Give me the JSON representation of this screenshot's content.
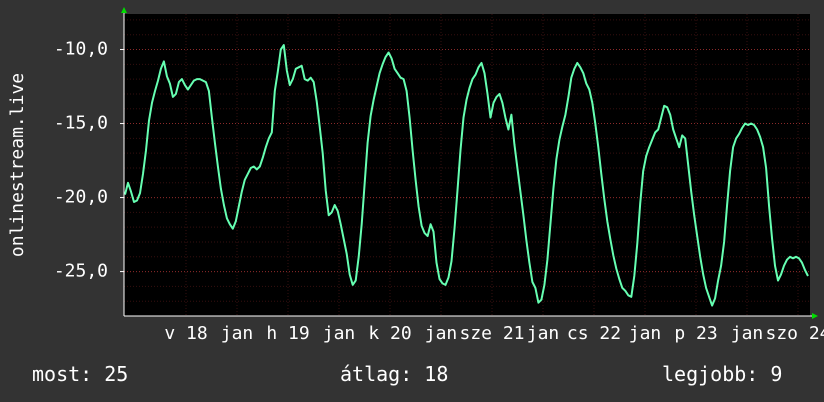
{
  "chart_data": {
    "type": "line",
    "ylabel": "onlinestream.live",
    "ylim": [
      -28,
      -7.6
    ],
    "y_ticks": [
      -10,
      -15,
      -20,
      -25
    ],
    "y_tick_labels": [
      "-10,0",
      "-15,0",
      "-20,0",
      "-25,0"
    ],
    "x_tick_labels": [
      "v 18",
      "jan",
      "h 19",
      "jan",
      "k 20",
      "jan",
      "sze 21",
      "jan",
      "cs 22",
      "jan",
      "p 23",
      "jan",
      "szo 24"
    ],
    "grid": true,
    "colors": {
      "background": "#333333",
      "plot": "#000000",
      "grid": "#5a1a1a",
      "axis": "#ffffff",
      "line": "#66ffb2",
      "marker": "#00dd00"
    },
    "series": [
      {
        "values": [
          -19.8,
          -19.0,
          -19.6,
          -20.3,
          -20.2,
          -19.7,
          -18.4,
          -16.8,
          -14.8,
          -13.6,
          -12.8,
          -12.1,
          -11.3,
          -10.8,
          -11.8,
          -12.3,
          -13.2,
          -13.0,
          -12.2,
          -12.0,
          -12.4,
          -12.7,
          -12.4,
          -12.1,
          -12.0,
          -12.0,
          -12.1,
          -12.2,
          -12.8,
          -14.6,
          -16.3,
          -17.9,
          -19.4,
          -20.5,
          -21.4,
          -21.8,
          -22.1,
          -21.6,
          -20.6,
          -19.6,
          -18.8,
          -18.4,
          -18.0,
          -17.9,
          -18.1,
          -17.9,
          -17.3,
          -16.6,
          -16.0,
          -15.6,
          -12.8,
          -11.5,
          -10.0,
          -9.7,
          -11.4,
          -12.4,
          -12.0,
          -11.3,
          -11.2,
          -11.1,
          -12.0,
          -12.1,
          -11.9,
          -12.2,
          -13.5,
          -15.2,
          -17.0,
          -19.5,
          -21.2,
          -21.0,
          -20.5,
          -20.9,
          -21.8,
          -22.8,
          -23.8,
          -25.2,
          -25.9,
          -25.6,
          -24.0,
          -21.8,
          -19.1,
          -16.3,
          -14.5,
          -13.4,
          -12.5,
          -11.6,
          -11.0,
          -10.5,
          -10.2,
          -10.6,
          -11.3,
          -11.6,
          -11.9,
          -12.0,
          -12.8,
          -14.6,
          -16.8,
          -18.8,
          -20.6,
          -21.9,
          -22.4,
          -22.6,
          -21.8,
          -22.3,
          -24.4,
          -25.5,
          -25.8,
          -25.9,
          -25.4,
          -24.3,
          -22.1,
          -19.5,
          -16.8,
          -14.6,
          -13.4,
          -12.6,
          -12.0,
          -11.7,
          -11.2,
          -10.9,
          -11.6,
          -13.0,
          -14.6,
          -13.6,
          -13.2,
          -13.0,
          -13.6,
          -14.6,
          -15.4,
          -14.4,
          -16.4,
          -18.0,
          -19.6,
          -21.2,
          -22.9,
          -24.4,
          -25.7,
          -26.1,
          -27.1,
          -26.9,
          -25.9,
          -24.2,
          -21.8,
          -19.4,
          -17.4,
          -16.1,
          -15.2,
          -14.4,
          -13.2,
          -11.9,
          -11.3,
          -10.9,
          -11.2,
          -11.6,
          -12.3,
          -12.7,
          -13.6,
          -15.0,
          -16.6,
          -18.4,
          -20.1,
          -21.6,
          -22.8,
          -23.9,
          -24.8,
          -25.5,
          -26.1,
          -26.3,
          -26.6,
          -26.7,
          -25.3,
          -23.1,
          -20.4,
          -18.2,
          -17.2,
          -16.6,
          -16.1,
          -15.6,
          -15.4,
          -14.6,
          -13.8,
          -13.9,
          -14.4,
          -15.4,
          -16.0,
          -16.6,
          -15.8,
          -16.0,
          -17.8,
          -19.6,
          -21.2,
          -22.6,
          -24.0,
          -25.2,
          -26.1,
          -26.7,
          -27.3,
          -26.8,
          -25.6,
          -24.6,
          -23.0,
          -20.5,
          -18.2,
          -16.6,
          -16.0,
          -15.7,
          -15.3,
          -15.0,
          -15.1,
          -15.0,
          -15.1,
          -15.4,
          -15.9,
          -16.6,
          -18.0,
          -20.6,
          -22.8,
          -24.6,
          -25.6,
          -25.2,
          -24.6,
          -24.2,
          -24.0,
          -24.1,
          -24.0,
          -24.1,
          -24.4,
          -24.9,
          -25.3
        ]
      }
    ]
  },
  "footer": {
    "current": "most: 25",
    "average": "átlag: 18",
    "best": "legjobb: 9"
  }
}
